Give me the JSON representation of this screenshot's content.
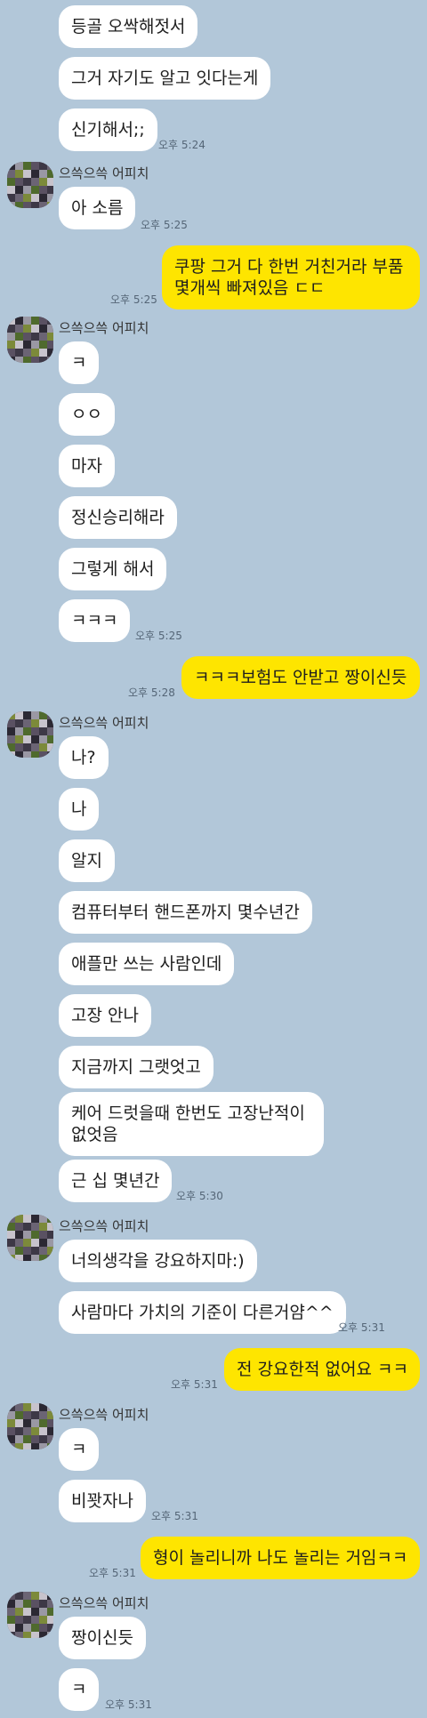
{
  "chat": {
    "partner_name": "으쓱으쓱 어피치",
    "messages": [
      {
        "id": 0,
        "side": "in",
        "text": "등골 오싹해젓서",
        "time": ""
      },
      {
        "id": 1,
        "side": "in",
        "text": "그거 자기도 알고 잇다는게",
        "time": ""
      },
      {
        "id": 2,
        "side": "in",
        "text": "신기해서;;",
        "time": "오후 5:24"
      },
      {
        "id": 3,
        "side": "in",
        "text": "아 소름",
        "time": "오후 5:25"
      },
      {
        "id": 4,
        "side": "out",
        "text": "쿠팡 그거 다 한번 거친거라 부품 몇개씩 빠져있음 ㄷㄷ",
        "time": "오후 5:25"
      },
      {
        "id": 5,
        "side": "in",
        "text": "ㅋ",
        "time": ""
      },
      {
        "id": 6,
        "side": "in",
        "text": "ㅇㅇ",
        "time": ""
      },
      {
        "id": 7,
        "side": "in",
        "text": "마자",
        "time": ""
      },
      {
        "id": 8,
        "side": "in",
        "text": "정신승리해라",
        "time": ""
      },
      {
        "id": 9,
        "side": "in",
        "text": "그렇게 해서",
        "time": ""
      },
      {
        "id": 10,
        "side": "in",
        "text": "ㅋㅋㅋ",
        "time": "오후 5:25"
      },
      {
        "id": 11,
        "side": "out",
        "text": "ㅋㅋㅋ보험도 안받고 짱이신듯",
        "time": "오후 5:28"
      },
      {
        "id": 12,
        "side": "in",
        "text": "나?",
        "time": ""
      },
      {
        "id": 13,
        "side": "in",
        "text": "나",
        "time": ""
      },
      {
        "id": 14,
        "side": "in",
        "text": "알지",
        "time": ""
      },
      {
        "id": 15,
        "side": "in",
        "text": "컴퓨터부터 핸드폰까지 몇수년간",
        "time": ""
      },
      {
        "id": 16,
        "side": "in",
        "text": "애플만 쓰는 사람인데",
        "time": ""
      },
      {
        "id": 17,
        "side": "in",
        "text": "고장 안나",
        "time": ""
      },
      {
        "id": 18,
        "side": "in",
        "text": "지금까지 그랫엇고",
        "time": ""
      },
      {
        "id": 19,
        "side": "in",
        "text": "케어 드럿을때 한번도 고장난적이 없엇음",
        "time": ""
      },
      {
        "id": 20,
        "side": "in",
        "text": "근 십 몇년간",
        "time": "오후 5:30"
      },
      {
        "id": 21,
        "side": "in",
        "text": "너의생각을 강요하지마:)",
        "time": ""
      },
      {
        "id": 22,
        "side": "in",
        "text": "사람마다 가치의 기준이 다른거얌^^",
        "time": "오후 5:31"
      },
      {
        "id": 23,
        "side": "out",
        "text": "전 강요한적 없어요 ㅋㅋ",
        "time": "오후 5:31"
      },
      {
        "id": 24,
        "side": "in",
        "text": "ㅋ",
        "time": ""
      },
      {
        "id": 25,
        "side": "in",
        "text": "비꽛자나",
        "time": "오후 5:31"
      },
      {
        "id": 26,
        "side": "out",
        "text": "형이 놀리니까 나도 놀리는 거임ㅋㅋ",
        "time": "오후 5:31"
      },
      {
        "id": 27,
        "side": "in",
        "text": "짱이신듯",
        "time": ""
      },
      {
        "id": 28,
        "side": "in",
        "text": "ㅋ",
        "time": "오후 5:31"
      }
    ]
  }
}
